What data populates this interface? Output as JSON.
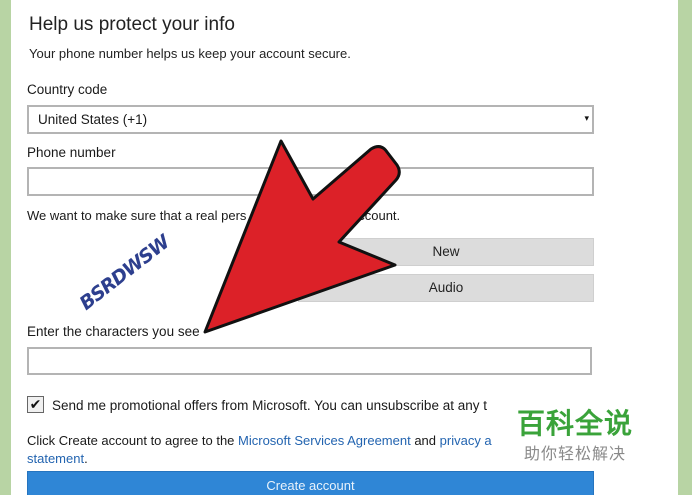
{
  "form": {
    "title": "Help us protect your info",
    "subtitle": "Your phone number helps us keep your account secure.",
    "country_code": {
      "label": "Country code",
      "value": "United States (+1)"
    },
    "phone": {
      "label": "Phone number",
      "value": ""
    },
    "verify_text": "We want to make sure that a real pers",
    "verify_text_tail": "account.",
    "captcha": {
      "text": "BSRDWSW",
      "new_label": "New",
      "audio_label": "Audio",
      "input_label": "Enter the characters you see",
      "input_value": ""
    },
    "promo": {
      "checked": true,
      "label": "Send me promotional offers from Microsoft. You can unsubscribe at any t"
    },
    "terms": {
      "prefix": "Click ",
      "bold": "Create account",
      "middle": " to agree to the ",
      "link1": "Microsoft Services Agreement",
      "and": " and ",
      "link2": "privacy a",
      "link2_tail": "statement",
      "suffix": "."
    },
    "create_label": "Create account"
  },
  "overlay": {
    "arrow_color": "#dc2128",
    "watermark_main": "百科全说",
    "watermark_sub": "助你轻松解决"
  }
}
